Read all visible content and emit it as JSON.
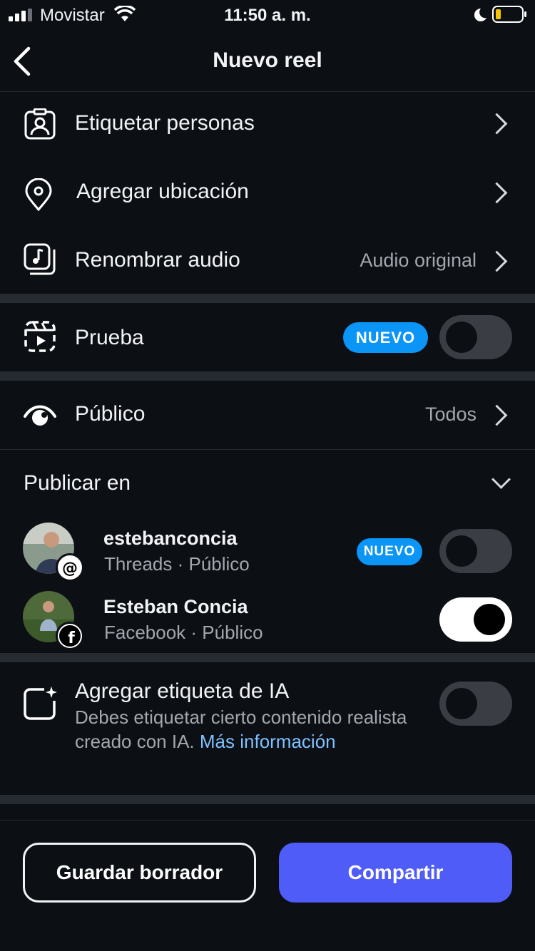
{
  "status_bar": {
    "carrier": "Movistar",
    "time": "11:50 a. m."
  },
  "header": {
    "title": "Nuevo reel"
  },
  "rows": {
    "tag_people": {
      "label": "Etiquetar personas"
    },
    "add_location": {
      "label": "Agregar ubicación"
    },
    "rename_audio": {
      "label": "Renombrar audio",
      "value": "Audio original"
    },
    "trial": {
      "label": "Prueba",
      "badge": "NUEVO",
      "toggle_on": false
    },
    "audience": {
      "label": "Público",
      "value": "Todos"
    }
  },
  "publish": {
    "title": "Publicar en",
    "accounts": [
      {
        "name": "estebanconcia",
        "platform": "Threads",
        "audience": "Público",
        "subtitle": "Threads · Público",
        "badge": "NUEVO",
        "toggle_on": false
      },
      {
        "name": "Esteban Concia",
        "platform": "Facebook",
        "audience": "Público",
        "subtitle": "Facebook · Público",
        "toggle_on": true
      }
    ]
  },
  "ai_label": {
    "title": "Agregar etiqueta de IA",
    "description": "Debes etiquetar cierto contenido realista creado con IA.",
    "link": "Más información",
    "toggle_on": false
  },
  "footer": {
    "draft_button": "Guardar borrador",
    "share_button": "Compartir"
  },
  "colors": {
    "background": "#0c0f14",
    "accent": "#4f5cf7",
    "badge": "#0a95f7",
    "link": "#7fc1ff"
  }
}
